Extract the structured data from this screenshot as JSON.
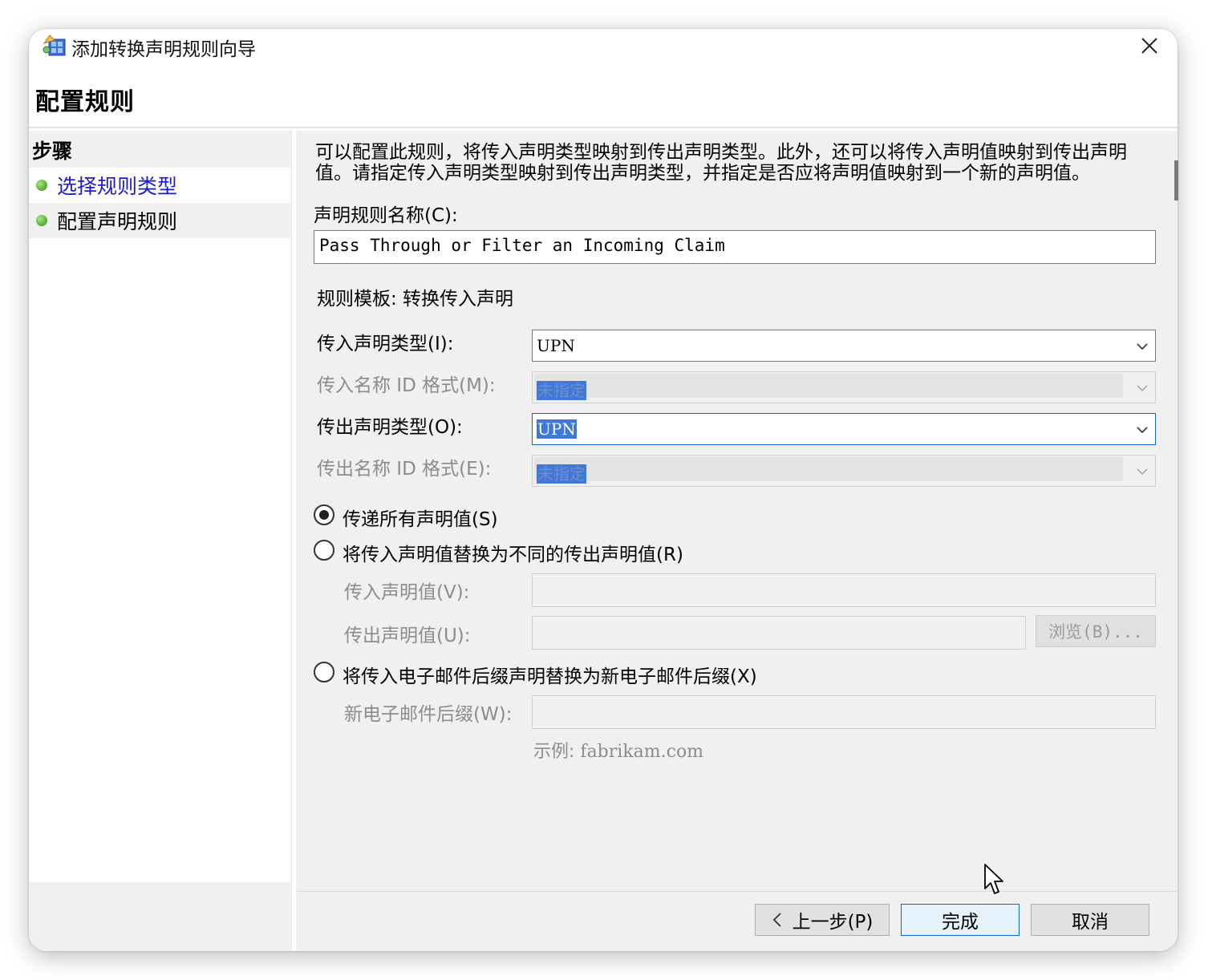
{
  "window": {
    "title": "添加转换声明规则向导",
    "heading": "配置规则"
  },
  "steps": {
    "header": "步骤",
    "items": [
      {
        "label": "选择规则类型",
        "state": "completed-link"
      },
      {
        "label": "配置声明规则",
        "state": "current"
      }
    ]
  },
  "form": {
    "description": "可以配置此规则，将传入声明类型映射到传出声明类型。此外，还可以将传入声明值映射到传出声明值。请指定传入声明类型映射到传出声明类型，并指定是否应将声明值映射到一个新的声明值。",
    "rule_name_label": "声明规则名称(C):",
    "rule_name_value": "Pass Through or Filter an Incoming Claim",
    "template_text": "规则模板: 转换传入声明",
    "incoming_type_label": "传入声明类型(I):",
    "incoming_type_value": "UPN",
    "incoming_nameid_label": "传入名称 ID 格式(M):",
    "incoming_nameid_value": "未指定",
    "outgoing_type_label": "传出声明类型(O):",
    "outgoing_type_value": "UPN",
    "outgoing_nameid_label": "传出名称 ID 格式(E):",
    "outgoing_nameid_value": "未指定",
    "radio_pass_all": "传递所有声明值(S)",
    "radio_replace_value": "将传入声明值替换为不同的传出声明值(R)",
    "incoming_value_label": "传入声明值(V):",
    "outgoing_value_label": "传出声明值(U):",
    "browse_label": "浏览(B)...",
    "radio_replace_suffix": "将传入电子邮件后缀声明替换为新电子邮件后缀(X)",
    "new_suffix_label": "新电子邮件后缀(W):",
    "example_prefix": "示例:",
    "example_value": "fabrikam.com",
    "selected_radio": "pass_all"
  },
  "footer": {
    "back_label": "上一步(P)",
    "finish_label": "完成",
    "cancel_label": "取消"
  },
  "colors": {
    "link": "#1a1ad6",
    "selection": "#3f78d8",
    "focus_border": "#0f66c9",
    "pane_bg": "#f0f0f0"
  },
  "icons": {
    "title": "wizard-app-icon",
    "close": "close-icon",
    "step": "green-status-dot-icon",
    "dropdown": "chevron-down-icon",
    "back": "chevron-left-icon",
    "cursor": "mouse-pointer-icon"
  }
}
